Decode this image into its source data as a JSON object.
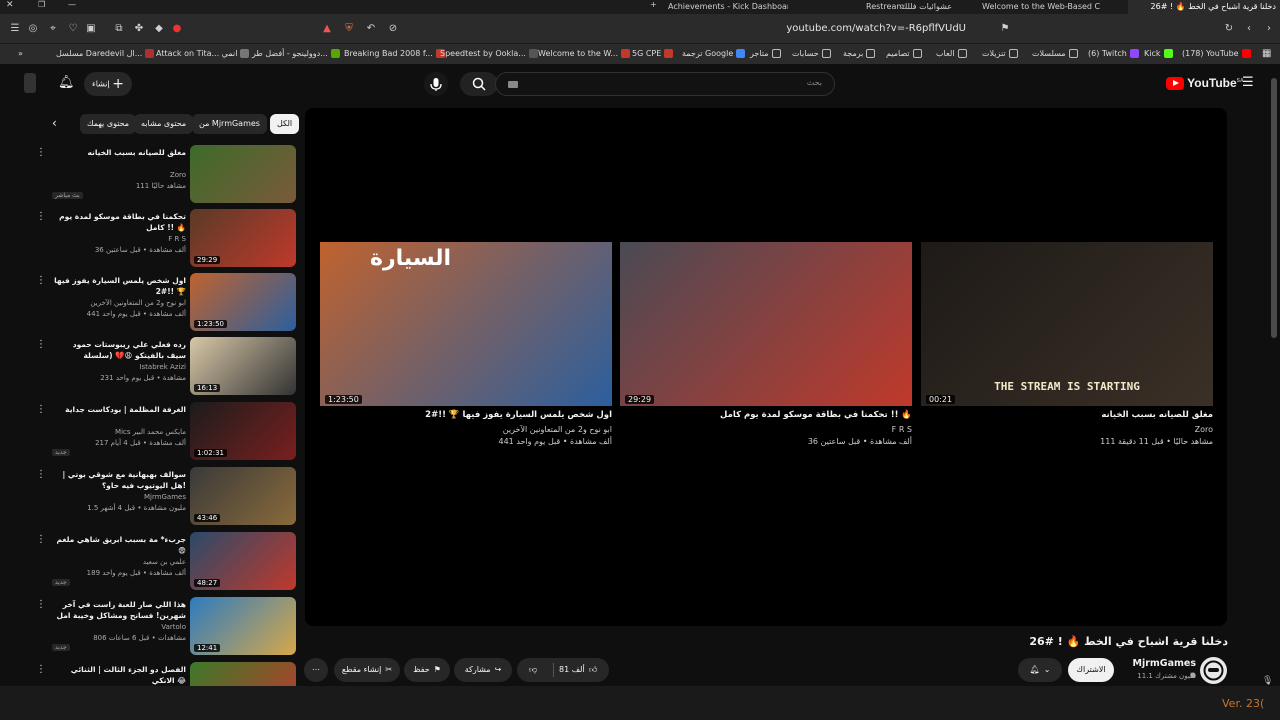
{
  "browser": {
    "tabs": [
      {
        "label": "Achievements - Kick Dashboard"
      },
      {
        "label": "عشوائيات فللك"
      },
      {
        "label": "Restream"
      },
      {
        "label": "Welcome to the Web-Based Config..."
      },
      {
        "label": "دخلنا قرية اشباح في الخط 🔥 ! #26"
      }
    ],
    "url": "youtube.com/watch?v=-R6pflfVUdU",
    "bookmarks": [
      {
        "label": "مسلسل Daredevil ال..."
      },
      {
        "label": "Attack on Tita... انمي"
      },
      {
        "label": "دوولينجو - أفضل طر..."
      },
      {
        "label": "Breaking Bad 2008 f..."
      },
      {
        "label": "Speedtest by Ookla..."
      },
      {
        "label": "Welcome to the W..."
      },
      {
        "label": "5G CPE"
      },
      {
        "label": "ترجمة Google"
      },
      {
        "label": "متاجر"
      },
      {
        "label": "حسابات"
      },
      {
        "label": "برمجة"
      },
      {
        "label": "تصاميم"
      },
      {
        "label": "العاب"
      },
      {
        "label": "تنزيلات"
      },
      {
        "label": "مسلسلات"
      },
      {
        "label": "(6) Twitch"
      },
      {
        "label": "Kick"
      },
      {
        "label": "(178) YouTube"
      }
    ]
  },
  "youtube": {
    "logo": "YouTube",
    "logo_sup": "SA",
    "search_placeholder": "بحث",
    "create_label": "إنشاء",
    "chips": [
      {
        "label": "الكل"
      },
      {
        "label": "من MjrmGames"
      },
      {
        "label": "محتوى مشابه"
      },
      {
        "label": "محتوى يهمك"
      }
    ],
    "recommended": [
      {
        "title": "مغلق للصيانه بسبب الخيانه",
        "channel": "Zoro",
        "meta": "111 مشاهد حاليًا",
        "duration": "",
        "badge": "بث مباشر",
        "colors": [
          "#3d6b2a",
          "#7a5a3a"
        ]
      },
      {
        "title": "تحكمنا في بطاقة موسكو لمدة يوم كامل !! 🔥",
        "channel": "F R S",
        "meta": "36 ألف مشاهدة • قبل ساعتين",
        "duration": "29:29",
        "badge": "",
        "colors": [
          "#5a3a28",
          "#c0392b"
        ]
      },
      {
        "title": "اول شخص يلمس السيارة يفوز فيها 🏆 !!#2",
        "channel": "ابو نوح و2 من المتعاونين الآخرين",
        "meta": "441 ألف مشاهدة • قبل يوم واحد",
        "duration": "1:23:50",
        "badge": "",
        "colors": [
          "#c0622e",
          "#2b5f9e"
        ]
      },
      {
        "title": "رده فعلي علي ريبوستات حمود سيف بالفيتكو 😩💔 (سلسلة جديدة!!)",
        "channel": "Istabrek Azizi",
        "meta": "231 مشاهدة • قبل يوم واحد",
        "duration": "16:13",
        "badge": "",
        "colors": [
          "#d8c8a8",
          "#333"
        ]
      },
      {
        "title": "الغرفة المظلمة | بودكاست جداية",
        "channel": "Mics مايكس محمد البير",
        "meta": "217 ألف مشاهدة • قبل 4 أيام",
        "duration": "1:02:31",
        "badge": "جديد",
        "colors": [
          "#1c1c1c",
          "#7a1f1f"
        ]
      },
      {
        "title": "سوالف بهبهانية مع شوقي بوتي | هل اليوتيوب فيه حاو؟!",
        "channel": "MjrmGames",
        "meta": "1.5 مليون مشاهدة • قبل 4 أشهر",
        "duration": "43:46",
        "badge": "",
        "colors": [
          "#3a3a3a",
          "#8a6a3a"
        ]
      },
      {
        "title": "جربء* مة بسبب ابريق شاهي ملغم 😨",
        "channel": "علمي بن سعيد",
        "meta": "189 ألف مشاهدة • قبل يوم واحد",
        "duration": "48:27",
        "badge": "جديد",
        "colors": [
          "#2a4a6a",
          "#c0392b"
        ]
      },
      {
        "title": "هذا اللي صار للعبة راست في آخر شهرين! فسانح ومشاكل وخيبة امل الموبايل ...",
        "channel": "Vartolo",
        "meta": "806 مشاهدات • قبل 6 ساعات",
        "duration": "12:41",
        "badge": "جديد",
        "colors": [
          "#2e7bbf",
          "#d6a84a"
        ]
      },
      {
        "title": "الفصل دو الجزء الثالث | الثنائي الانكي 😂",
        "channel": "",
        "meta": "",
        "duration": "",
        "badge": "",
        "colors": [
          "#3a7a2a",
          "#c0392b"
        ]
      }
    ],
    "endscreen": [
      {
        "title": "اول شخص يلمس السيارة يفوز فيها 🏆 !!#2",
        "channel": "ابو نوح و2 من المتعاونين الآخرين",
        "meta": "441 ألف مشاهدة • قبل يوم واحد",
        "duration": "1:23:50",
        "overlay": "السيارة",
        "colors": [
          "#c0622e",
          "#2b5f9e"
        ]
      },
      {
        "title": "تحكمنا في بطاقة موسكو لمدة يوم كامل !! 🔥",
        "channel": "F R S",
        "meta": "36 ألف مشاهدة • قبل ساعتين",
        "duration": "29:29",
        "overlay": "",
        "colors": [
          "#4a4a55",
          "#c0392b"
        ]
      },
      {
        "title": "مغلق للصيانه بسبب الخيانه",
        "channel": "Zoro",
        "meta": "111 مشاهد حاليًا • قبل 11 دقيقة",
        "duration": "00:21",
        "overlay": "THE STREAM IS STARTING",
        "colors": [
          "#1e1a17",
          "#3a3027"
        ]
      }
    ],
    "video": {
      "title": "دخلنا قرية اشباح في الخط 🔥 ! #26",
      "channel": "MjrmGames",
      "subscribers": "11.1 مليون مشترك",
      "subscribe_label": "الاشتراك",
      "likes": "81 ألف",
      "share_label": "مشاركة",
      "save_label": "حفظ",
      "clip_label": "إنشاء مقطع"
    }
  },
  "overlay_version": "Ver. 23("
}
